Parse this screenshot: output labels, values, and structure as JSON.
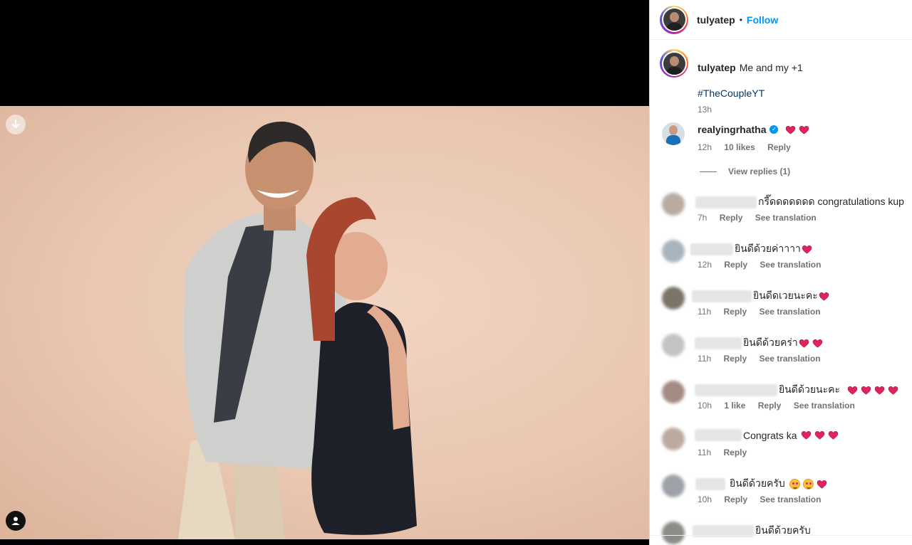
{
  "post": {
    "username": "tulyatep",
    "follow_label": "Follow",
    "separator": "•",
    "caption_text": "Me and my +1",
    "hashtag": "#TheCoupleYT",
    "time": "13h"
  },
  "featured_comment": {
    "username": "realyingrhatha",
    "verified": true,
    "hearts": 2,
    "time": "12h",
    "likes": "10 likes",
    "reply_label": "Reply",
    "view_replies": "View replies (1)"
  },
  "comments": [
    {
      "text": "กรี๊ดดดดดดด congratulations kup",
      "time": "7h",
      "likes": "",
      "reply": "Reply",
      "translate": "See translation"
    },
    {
      "text": "ยินดีด้วยค่าาาา",
      "time": "12h",
      "likes": "",
      "reply": "Reply",
      "translate": "See translation"
    },
    {
      "text": "ยินดีดเวยนะคะ",
      "time": "11h",
      "likes": "",
      "reply": "Reply",
      "translate": "See translation"
    },
    {
      "text": "ยินดีด้วยคร่า",
      "time": "11h",
      "likes": "",
      "reply": "Reply",
      "translate": "See translation"
    },
    {
      "text": "ยินดีด้วยนะคะ",
      "time": "10h",
      "likes": "1 like",
      "reply": "Reply",
      "translate": "See translation"
    },
    {
      "text": "Congrats ka",
      "time": "11h",
      "likes": "",
      "reply": "Reply",
      "translate": ""
    },
    {
      "text": "ยินดีด้วยครับ",
      "time": "10h",
      "likes": "",
      "reply": "Reply",
      "translate": "See translation"
    },
    {
      "text": "ยินดีด้วยครับ",
      "time": "",
      "likes": "",
      "reply": "",
      "translate": ""
    }
  ],
  "icons": {
    "download": "arrow-down-icon",
    "tags": "user-icon",
    "heart": "red-heart-emoji",
    "smiling_face": "smiling-face-with-hearts-emoji"
  },
  "colors": {
    "accent_blue": "#0095f6",
    "hashtag_blue": "#00376b",
    "heart_red": "#e0245e",
    "meta_grey": "#737373",
    "photo_background": "#e9c7b1"
  }
}
